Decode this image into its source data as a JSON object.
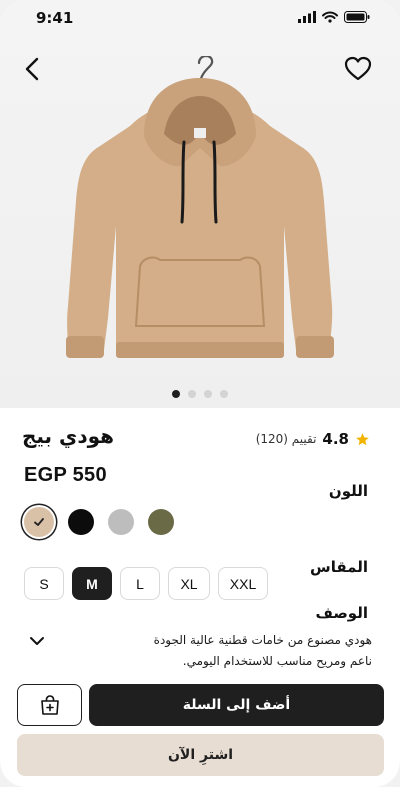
{
  "status_bar": {
    "time": "9:41"
  },
  "product": {
    "title": "هودي بيج",
    "rating_score": "4.8",
    "rating_count": "(120) تقييم",
    "price": "EGP 550",
    "image_count": 4,
    "active_image": 1
  },
  "labels": {
    "color": "اللون",
    "size": "المقاس",
    "description": "الوصف"
  },
  "colors": [
    {
      "name": "beige",
      "hex": "#d9c1a8",
      "selected": true
    },
    {
      "name": "black",
      "hex": "#0c0c0c",
      "selected": false
    },
    {
      "name": "gray",
      "hex": "#bdbdbd",
      "selected": false
    },
    {
      "name": "olive",
      "hex": "#6b6a47",
      "selected": false
    }
  ],
  "sizes": [
    "S",
    "M",
    "L",
    "XL",
    "XXL"
  ],
  "selected_size": "M",
  "description": {
    "line1": "هودي مصنوع من خامات قطنية عالية الجودة",
    "line2": "ناعم ومريح مناسب للاستخدام اليومي."
  },
  "actions": {
    "add_to_cart": "أضف إلى السلة",
    "buy_now": "اشترِ الآن"
  },
  "colors_theme": {
    "primary_dark": "#1f1f1f",
    "accent_beige": "#e7ddd2",
    "star": "#f2b400"
  },
  "icons": {
    "back": "chevron-left-icon",
    "favorite": "heart-icon",
    "expand": "chevron-down-icon",
    "cart": "shopping-bag-plus-icon",
    "rating": "star-icon"
  }
}
